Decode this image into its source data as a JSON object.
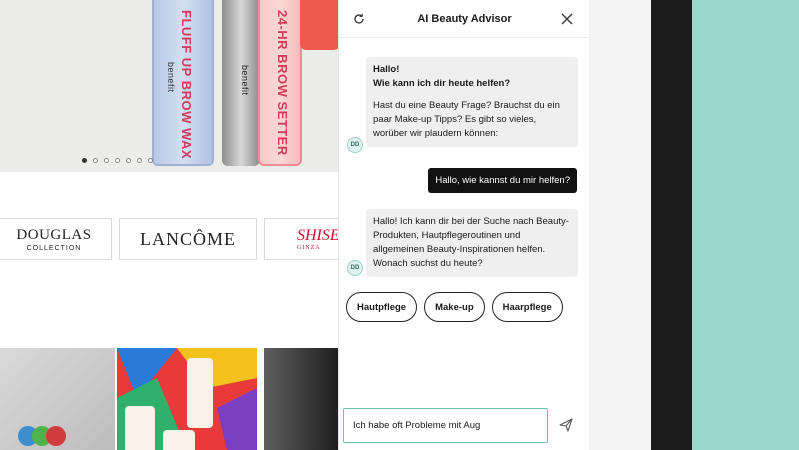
{
  "page": {
    "hero": {
      "products": [
        {
          "name": "FLUFF UP BROW WAX",
          "brand": "benefit"
        },
        {
          "name": "24-HR BROW SETTER",
          "brand": "benefit"
        }
      ],
      "carousel": {
        "count": 7,
        "active_index": 0
      }
    },
    "brands": [
      {
        "name": "DOUGLAS",
        "subtitle": "COLLECTION"
      },
      {
        "name": "LANCÔME",
        "subtitle": ""
      },
      {
        "name": "SHISEI",
        "subtitle": "GINZA"
      }
    ]
  },
  "chat": {
    "title": "AI Beauty Advisor",
    "avatar_label": "DD",
    "messages": [
      {
        "role": "bot",
        "greeting_line1": "Hallo!",
        "greeting_line2": "Wie kann ich dir heute helfen?",
        "text": "Hast du eine Beauty Frage? Brauchst du ein paar Make-up Tipps? Es gibt so vieles, worüber wir plaudern können:"
      },
      {
        "role": "user",
        "text": "Hallo, wie kannst du mir helfen?"
      },
      {
        "role": "bot",
        "text": "Hallo! Ich kann dir bei der Suche nach Beauty-Produkten, Hautpflegeroutinen und allgemeinen Beauty-Inspirationen helfen. Wonach suchst du heute?"
      }
    ],
    "suggestions": [
      "Hautpflege",
      "Make-up",
      "Haarpflege"
    ],
    "input": {
      "value": "Ich habe oft Probleme mit Aug",
      "placeholder": ""
    }
  },
  "colors": {
    "accent": "#6fc3b6",
    "background_right": "#9ad8ce",
    "user_bubble": "#111111",
    "bot_bubble": "#efefef"
  },
  "icons": {
    "refresh": "refresh-icon",
    "close": "close-icon",
    "send": "send-icon"
  }
}
